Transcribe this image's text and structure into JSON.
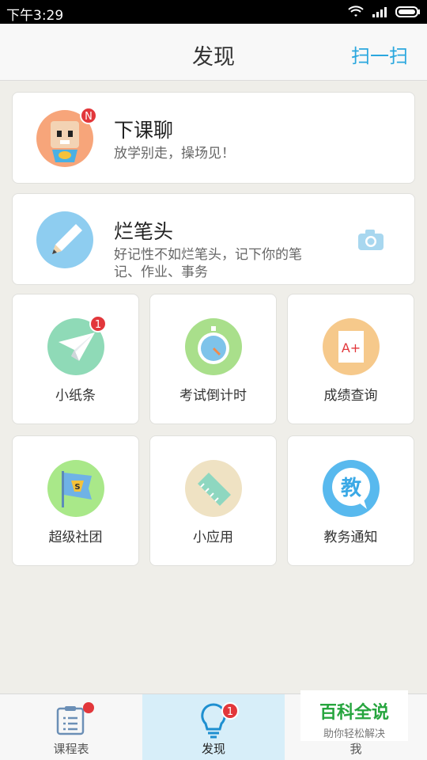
{
  "status_bar": {
    "time": "下午3:29"
  },
  "nav": {
    "title": "发现",
    "scan_label": "扫一扫"
  },
  "cards": [
    {
      "title": "下课聊",
      "subtitle": "放学别走，操场见！",
      "badge": "N"
    },
    {
      "title": "烂笔头",
      "subtitle": "好记性不如烂笔头，记下你的笔记、作业、事务"
    }
  ],
  "tiles": [
    {
      "label": "小纸条",
      "badge": "1"
    },
    {
      "label": "考试倒计时"
    },
    {
      "label": "成绩查询",
      "icon_text": "A+"
    },
    {
      "label": "超级社团",
      "icon_text": "S"
    },
    {
      "label": "小应用"
    },
    {
      "label": "教务通知",
      "icon_text": "教"
    }
  ],
  "tabbar": {
    "items": [
      {
        "label": "课程表"
      },
      {
        "label": "发现",
        "badge": "1",
        "active": true
      },
      {
        "label": "我"
      }
    ]
  },
  "watermark": {
    "title": "百科全说",
    "subtitle": "助你轻松解决"
  },
  "colors": {
    "accent": "#2aa7de",
    "badge": "#e2373b",
    "active_tab_bg": "#d7eef9"
  }
}
